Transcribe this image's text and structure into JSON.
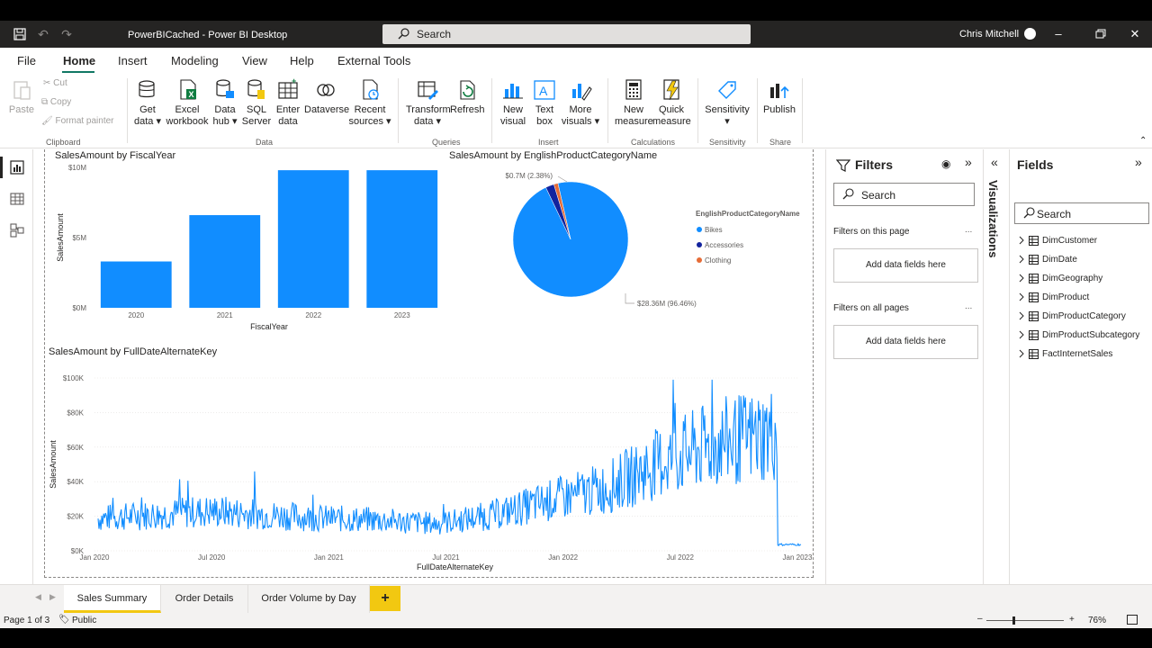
{
  "titlebar": {
    "file_name": "PowerBICached - Power BI Desktop",
    "search_placeholder": "Search",
    "user": "Chris Mitchell"
  },
  "menu": [
    "File",
    "Home",
    "Insert",
    "Modeling",
    "View",
    "Help",
    "External Tools"
  ],
  "ribbon": {
    "clipboard": {
      "paste": "Paste",
      "cut": "Cut",
      "copy": "Copy",
      "format_painter": "Format painter",
      "label": "Clipboard"
    },
    "data": {
      "get_data": [
        "Get",
        "data ▾"
      ],
      "excel": [
        "Excel",
        "workbook"
      ],
      "data_hub": [
        "Data",
        "hub ▾"
      ],
      "sql": [
        "SQL",
        "Server"
      ],
      "enter_data": [
        "Enter",
        "data"
      ],
      "dataverse": [
        "Dataverse"
      ],
      "recent": [
        "Recent",
        "sources ▾"
      ],
      "label": "Data"
    },
    "queries": {
      "transform": [
        "Transform",
        "data ▾"
      ],
      "refresh": [
        "Refresh"
      ],
      "label": "Queries"
    },
    "insert": {
      "new_visual": [
        "New",
        "visual"
      ],
      "text_box": [
        "Text",
        "box"
      ],
      "more_visuals": [
        "More",
        "visuals ▾"
      ],
      "label": "Insert"
    },
    "calculations": {
      "new_measure": [
        "New",
        "measure"
      ],
      "quick_measure": [
        "Quick",
        "measure"
      ],
      "label": "Calculations"
    },
    "sensitivity": {
      "sensitivity": [
        "Sensitivity",
        "▾"
      ],
      "label": "Sensitivity"
    },
    "share": {
      "publish": [
        "Publish"
      ],
      "label": "Share"
    }
  },
  "charts": {
    "bar_title": "SalesAmount by FiscalYear",
    "pie_title": "SalesAmount by EnglishProductCategoryName",
    "line_title": "SalesAmount by FullDateAlternateKey"
  },
  "chart_data": [
    {
      "type": "bar",
      "title": "SalesAmount by FiscalYear",
      "categories": [
        "2020",
        "2021",
        "2022",
        "2023"
      ],
      "values": [
        3.3,
        6.6,
        9.8,
        9.8
      ],
      "unit": "M",
      "xlabel": "FiscalYear",
      "ylabel": "SalesAmount",
      "yticks": [
        "$0M",
        "$5M",
        "$10M"
      ],
      "ylim": [
        0,
        10
      ],
      "color": "#118dff"
    },
    {
      "type": "pie",
      "title": "SalesAmount by EnglishProductCategoryName",
      "legend_title": "EnglishProductCategoryName",
      "slices": [
        {
          "name": "Bikes",
          "pct": 96.46,
          "color": "#118dff"
        },
        {
          "name": "Accessories",
          "pct": 2.38,
          "color": "#12239e"
        },
        {
          "name": "Clothing",
          "pct": 1.16,
          "color": "#e66c37"
        }
      ],
      "data_labels": [
        "$0.7M (2.38%)",
        "$28.36M (96.46%)"
      ]
    },
    {
      "type": "line",
      "title": "SalesAmount by FullDateAlternateKey",
      "xlabel": "FullDateAlternateKey",
      "ylabel": "SalesAmount",
      "xticks": [
        "Jan 2020",
        "Jul 2020",
        "Jan 2021",
        "Jul 2021",
        "Jan 2022",
        "Jul 2022",
        "Jan 2023"
      ],
      "yticks": [
        "$0K",
        "$20K",
        "$40K",
        "$60K",
        "$80K",
        "$100K"
      ],
      "ylim": [
        0,
        100
      ],
      "x": [
        "Jan 2020",
        "Apr 2020",
        "Jul 2020",
        "Oct 2020",
        "Jan 2021",
        "Apr 2021",
        "Jul 2021",
        "Oct 2021",
        "Jan 2022",
        "Apr 2022",
        "Jul 2022",
        "Oct 2022",
        "Dec 2022",
        "Jan 2023"
      ],
      "values": [
        18,
        20,
        22,
        20,
        18,
        17,
        15,
        20,
        28,
        35,
        50,
        60,
        65,
        3
      ],
      "color": "#118dff"
    }
  ],
  "filters": {
    "title": "Filters",
    "search": "Search",
    "this_page": "Filters on this page",
    "all_pages": "Filters on all pages",
    "add_fields": "Add data fields here",
    "more": "..."
  },
  "visualizations": {
    "title": "Visualizations"
  },
  "fields": {
    "title": "Fields",
    "search": "Search",
    "tables": [
      "DimCustomer",
      "DimDate",
      "DimGeography",
      "DimProduct",
      "DimProductCategory",
      "DimProductSubcategory",
      "FactInternetSales"
    ]
  },
  "pages": [
    "Sales Summary",
    "Order Details",
    "Order Volume by Day"
  ],
  "status": {
    "page": "Page 1 of 3",
    "sensitivity": "Public",
    "zoom": "76%"
  }
}
